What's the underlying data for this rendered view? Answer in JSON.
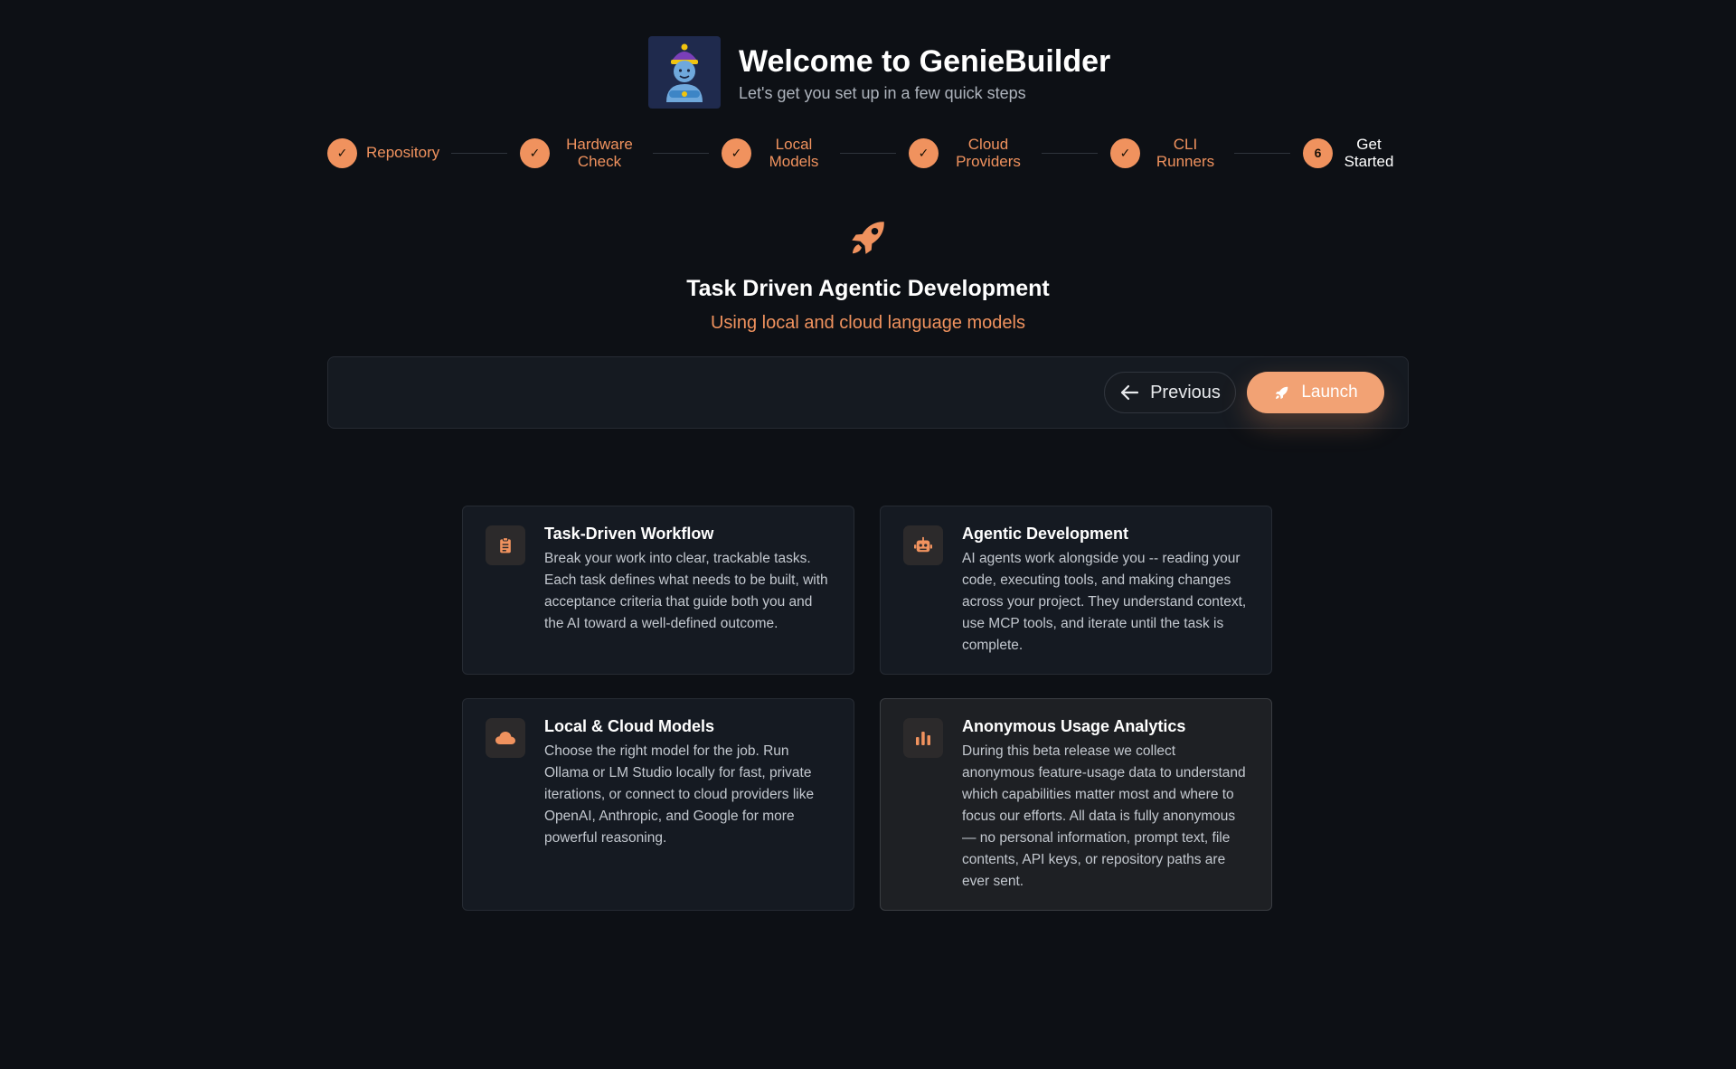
{
  "header": {
    "title": "Welcome to GenieBuilder",
    "subtitle": "Let's get you set up in a few quick steps"
  },
  "stepper": {
    "steps": [
      {
        "label": "Repository",
        "status": "complete",
        "icon": "check-icon"
      },
      {
        "label": "Hardware Check",
        "status": "complete",
        "icon": "check-icon"
      },
      {
        "label": "Local Models",
        "status": "complete",
        "icon": "check-icon"
      },
      {
        "label": "Cloud Providers",
        "status": "complete",
        "icon": "check-icon"
      },
      {
        "label": "CLI Runners",
        "status": "complete",
        "icon": "check-icon"
      },
      {
        "label": "Get Started",
        "status": "active",
        "number": "6"
      }
    ]
  },
  "hero": {
    "icon": "rocket-icon",
    "title": "Task Driven Agentic Development",
    "subtitle": "Using local and cloud language models"
  },
  "actions": {
    "previous_label": "Previous",
    "launch_label": "Launch"
  },
  "features": [
    {
      "icon": "clipboard-icon",
      "title": "Task-Driven Workflow",
      "text": "Break your work into clear, trackable tasks. Each task defines what needs to be built, with acceptance criteria that guide both you and the AI toward a well-defined outcome."
    },
    {
      "icon": "robot-icon",
      "title": "Agentic Development",
      "text": "AI agents work alongside you -- reading your code, executing tools, and making changes across your project. They understand context, use MCP tools, and iterate until the task is complete."
    },
    {
      "icon": "cloud-icon",
      "title": "Local & Cloud Models",
      "text": "Choose the right model for the job. Run Ollama or LM Studio locally for fast, private iterations, or connect to cloud providers like OpenAI, Anthropic, and Google for more powerful reasoning."
    },
    {
      "icon": "bar-chart-icon",
      "title": "Anonymous Usage Analytics",
      "text": "During this beta release we collect anonymous feature-usage data to understand which capabilities matter most and where to focus our efforts. All data is fully anonymous — no personal information, prompt text, file contents, API keys, or repository paths are ever sent."
    }
  ],
  "colors": {
    "accent": "#f0925e",
    "background": "#0d1015",
    "card": "#151a22"
  }
}
